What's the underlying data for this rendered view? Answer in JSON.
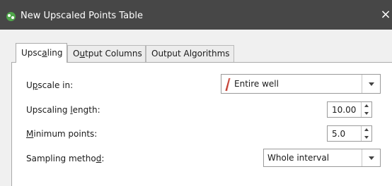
{
  "window": {
    "title": "New Upscaled Points Table",
    "close_symbol": "×",
    "icon": "leapfrog-app-icon"
  },
  "tabs": [
    {
      "label": "Upscaling",
      "mnemonic_index": 4,
      "active": true
    },
    {
      "label": "Output Columns",
      "mnemonic_index": 1,
      "active": false
    },
    {
      "label": "Output Algorithms",
      "mnemonic_index": -1,
      "active": false
    }
  ],
  "form": {
    "upscale_in": {
      "label": "Upscale in:",
      "mnemonic_index": 1,
      "value": "Entire well",
      "icon": "well-trace-icon"
    },
    "upscaling_length": {
      "label": "Upscaling length:",
      "mnemonic_index": 10,
      "value": "10.00"
    },
    "minimum_points": {
      "label": "Minimum points:",
      "mnemonic_index": 0,
      "value": "5.0"
    },
    "sampling_method": {
      "label": "Sampling method:",
      "mnemonic_index": 14,
      "value": "Whole interval"
    }
  },
  "colors": {
    "titlebar": "#474747",
    "app_icon": "#4fa64a",
    "well_icon": "#c0392b",
    "dialog_bg": "#f0f0f0"
  }
}
